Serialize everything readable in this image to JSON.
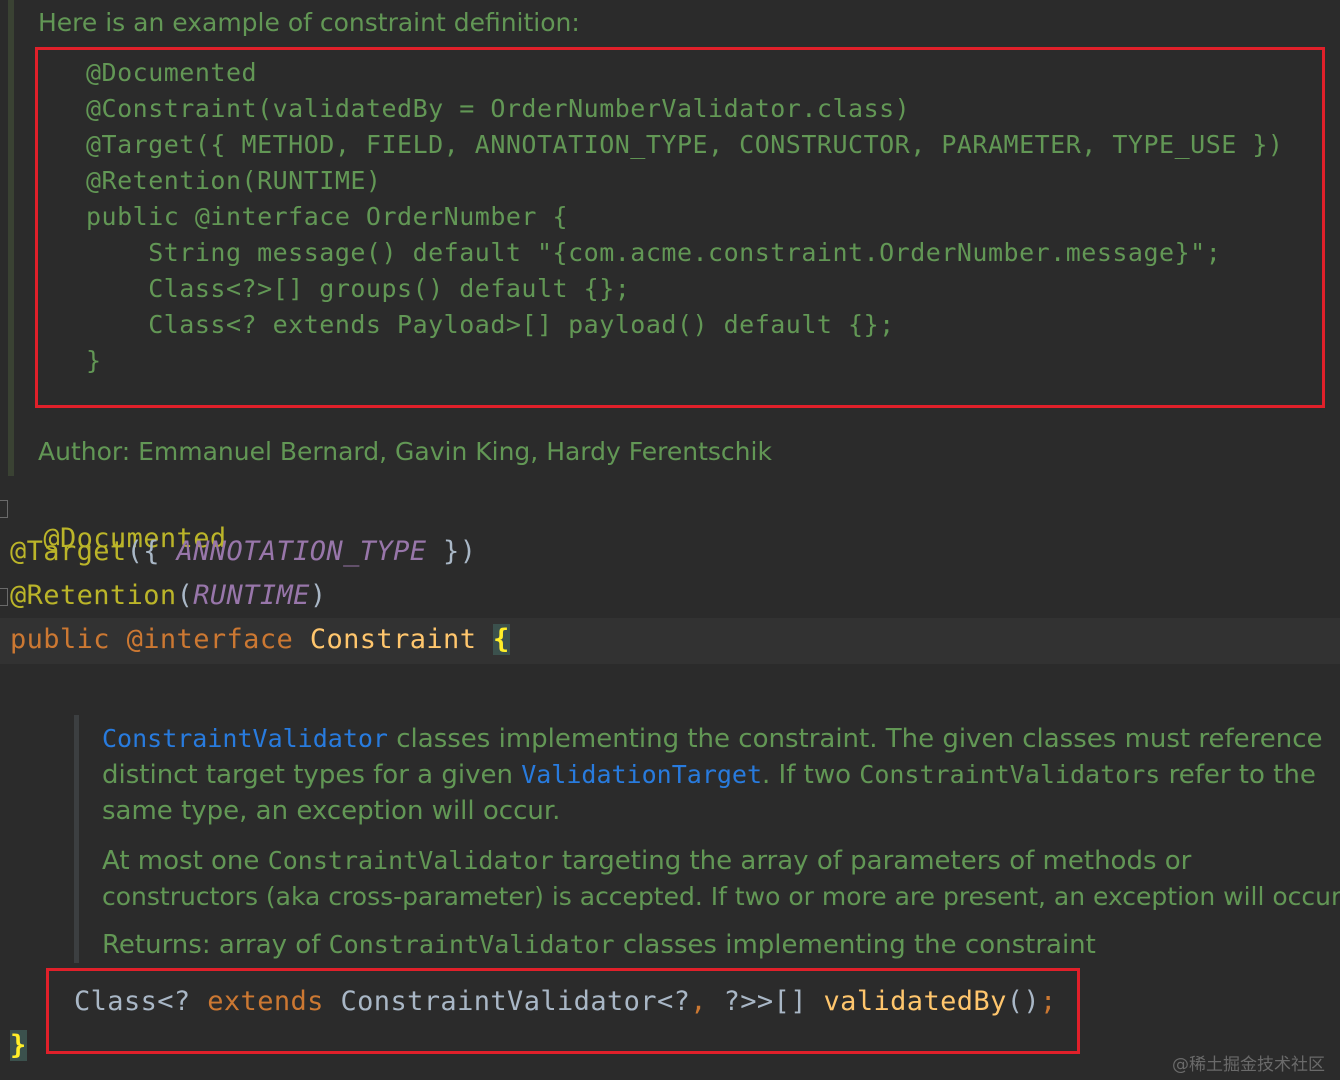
{
  "top_doc": {
    "intro": "Here is an example of constraint definition:",
    "example_lines": [
      "@Documented",
      "@Constraint(validatedBy = OrderNumberValidator.class)",
      "@Target({ METHOD, FIELD, ANNOTATION_TYPE, CONSTRUCTOR, PARAMETER, TYPE_USE })",
      "@Retention(RUNTIME)",
      "public @interface OrderNumber {",
      "    String message() default \"{com.acme.constraint.OrderNumber.message}\";",
      "    Class<?>[] groups() default {};",
      "    Class<? extends Payload>[] payload() default {};",
      "}"
    ],
    "author": "Author: Emmanuel Bernard, Gavin King, Hardy Ferentschik"
  },
  "code": {
    "line1": {
      "ann": "@Documented"
    },
    "line2": {
      "ann": "@Target",
      "open": "({ ",
      "const": "ANNOTATION_TYPE",
      "close": " })"
    },
    "line3": {
      "ann": "@Retention",
      "open": "(",
      "const": "RUNTIME",
      "close": ")"
    },
    "line4": {
      "kw1": "public",
      "kw2": "@interface",
      "name": "Constraint",
      "brace": "{"
    },
    "method": {
      "type1": "Class<? ",
      "kw": "extends",
      "type2": " ConstraintValidator<?",
      "comma": ",",
      "type3": " ?>>[] ",
      "name": "validatedBy",
      "parens": "()",
      "semi": ";"
    },
    "closing_brace": "}"
  },
  "inner_doc": {
    "p1": {
      "link1": "ConstraintValidator",
      "t1": " classes implementing the constraint. The given classes must reference",
      "t2": "distinct target types for a given ",
      "link2": "ValidationTarget",
      "t3": ". If two ",
      "code1": "ConstraintValidators",
      "t4": " refer to the",
      "t5": "same type, an exception will occur."
    },
    "p2": {
      "t1": "At most one ",
      "code1": "ConstraintValidator",
      "t2": " targeting the array of parameters of methods or",
      "t3": "constructors (aka cross-parameter) is accepted. If two or more are present, an exception will occur."
    },
    "returns": {
      "t1": "Returns: array of ",
      "code1": "ConstraintValidator",
      "t2": " classes implementing the constraint"
    }
  },
  "watermark": "@稀土掘金技术社区",
  "colors": {
    "background": "#2b2b2b",
    "doc_green": "#629755",
    "annotation": "#bbb529",
    "keyword": "#cc7832",
    "constant": "#9876aa",
    "link": "#287bde",
    "highlight_box": "#e0202a"
  }
}
